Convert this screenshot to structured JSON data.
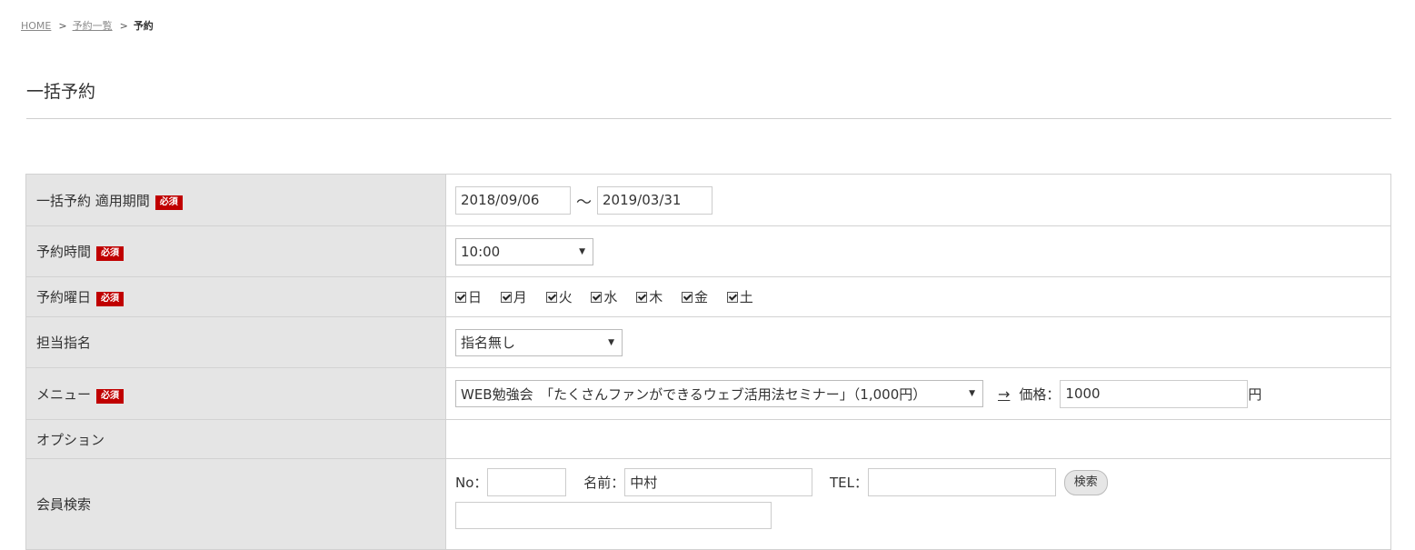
{
  "breadcrumb": {
    "home": "HOME",
    "sep1": ">",
    "list": "予約一覧",
    "sep2": ">",
    "current": "予約"
  },
  "page_title": "一括予約",
  "badge_required": "必須",
  "rows": {
    "period": {
      "label": "一括予約 適用期間",
      "start": "2018/09/06",
      "tilde": "〜",
      "end": "2019/03/31"
    },
    "time": {
      "label": "予約時間",
      "value": "10:00"
    },
    "weekdays": {
      "label": "予約曜日",
      "days": [
        "日",
        "月",
        "火",
        "水",
        "木",
        "金",
        "土"
      ]
    },
    "staff": {
      "label": "担当指名",
      "value": "指名無し"
    },
    "menu": {
      "label": "メニュー",
      "value": "WEB勉強会　「たくさんファンができるウェブ活用法セミナー」（1,000円）",
      "arrow": "→",
      "price_label": "価格：",
      "price_value": "1000",
      "yen": "円"
    },
    "option": {
      "label": "オプション"
    },
    "member": {
      "label": "会員検索",
      "no_label": "No：",
      "no_value": "",
      "name_label": "名前：",
      "name_value": "中村",
      "tel_label": "TEL：",
      "tel_value": "",
      "search_button": "検索"
    }
  },
  "colors": {
    "badge": "#c00000",
    "header_bg": "#e5e5e5",
    "border": "#d2d2d2"
  },
  "icons": {
    "caret": "caret-down-icon",
    "checkbox": "checkbox-checked-icon"
  }
}
